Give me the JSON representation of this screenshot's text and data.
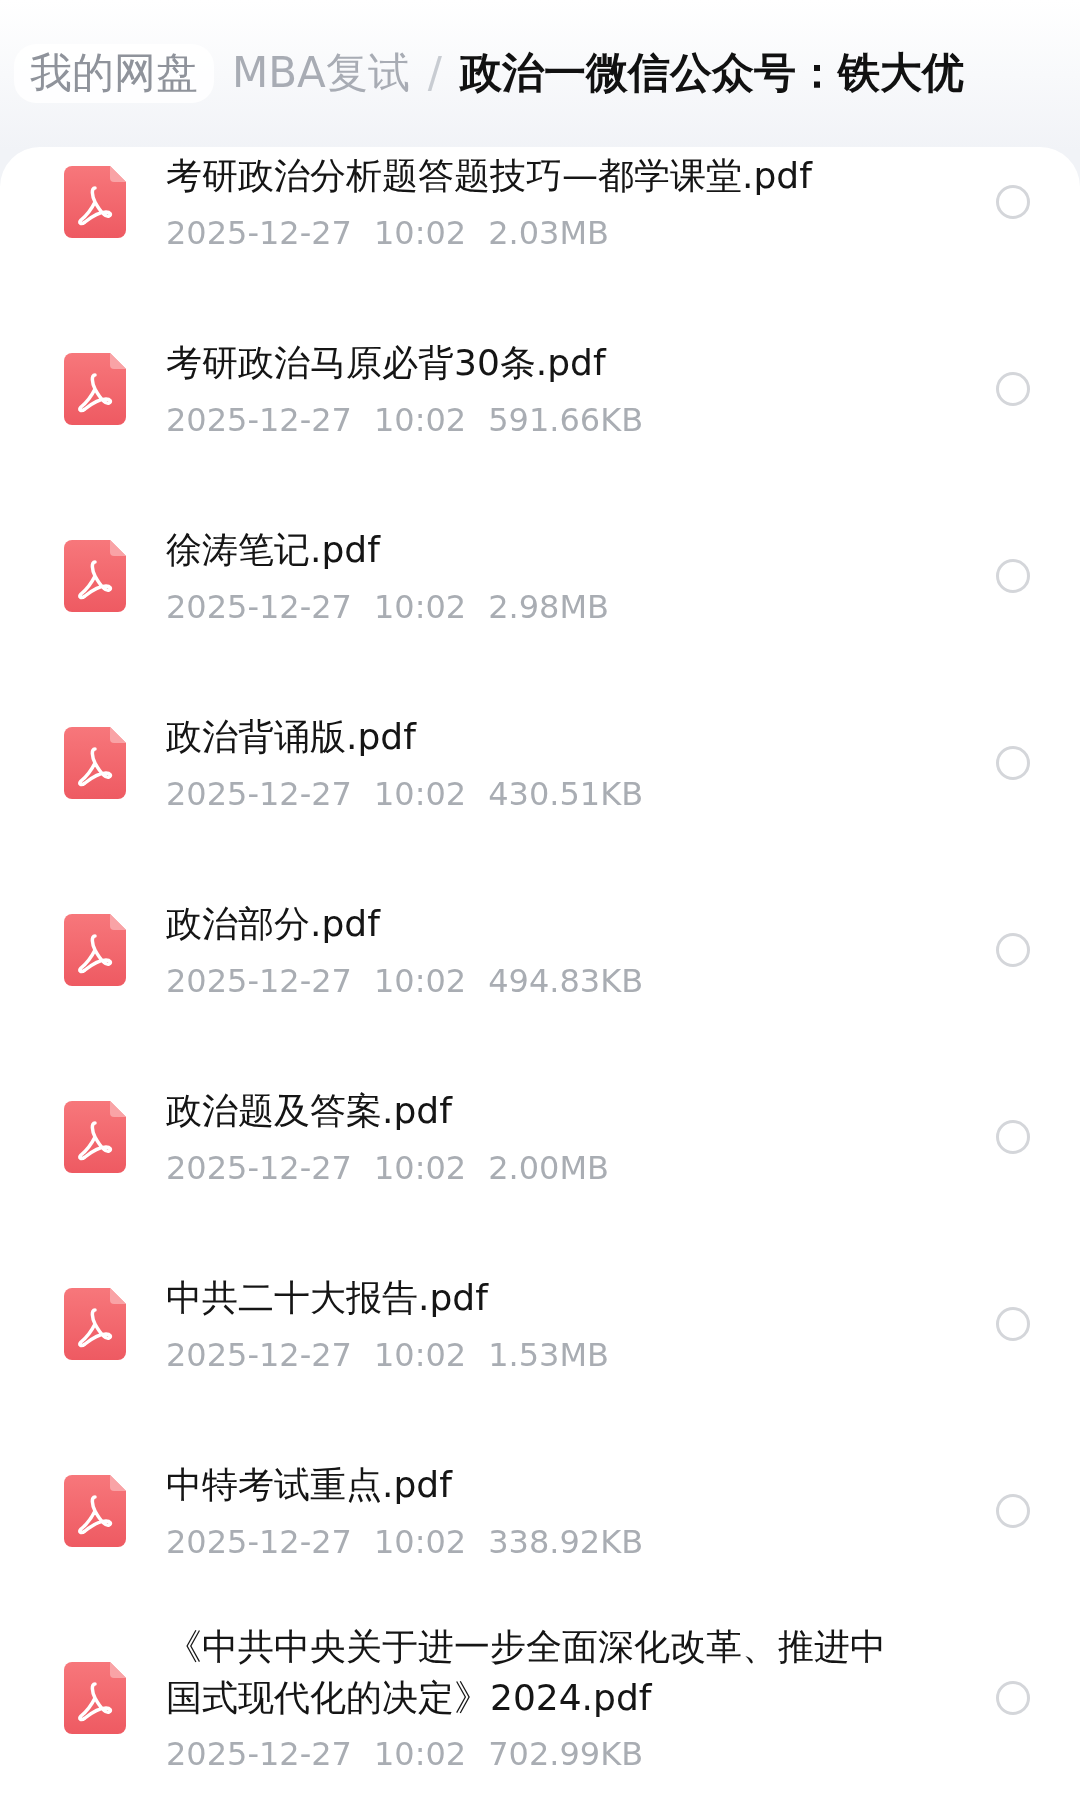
{
  "breadcrumb": [
    {
      "label": "我的网盘",
      "kind": "root"
    },
    {
      "label": "MBA复试",
      "kind": "folder"
    },
    {
      "label": "/",
      "kind": "separator"
    },
    {
      "label": "政治一微信公众号：铁大优",
      "kind": "current"
    }
  ],
  "files": [
    {
      "name": "考研政治分析题答题技巧—都学课堂.pdf",
      "date": "2025-12-27",
      "time": "10:02",
      "size": "2.03MB",
      "selected": false
    },
    {
      "name": "考研政治马原必背30条.pdf",
      "date": "2025-12-27",
      "time": "10:02",
      "size": "591.66KB",
      "selected": false
    },
    {
      "name": "徐涛笔记.pdf",
      "date": "2025-12-27",
      "time": "10:02",
      "size": "2.98MB",
      "selected": false
    },
    {
      "name": "政治背诵版.pdf",
      "date": "2025-12-27",
      "time": "10:02",
      "size": "430.51KB",
      "selected": false
    },
    {
      "name": "政治部分.pdf",
      "date": "2025-12-27",
      "time": "10:02",
      "size": "494.83KB",
      "selected": false
    },
    {
      "name": "政治题及答案.pdf",
      "date": "2025-12-27",
      "time": "10:02",
      "size": "2.00MB",
      "selected": false
    },
    {
      "name": "中共二十大报告.pdf",
      "date": "2025-12-27",
      "time": "10:02",
      "size": "1.53MB",
      "selected": false
    },
    {
      "name": "中特考试重点.pdf",
      "date": "2025-12-27",
      "time": "10:02",
      "size": "338.92KB",
      "selected": false
    },
    {
      "name": "《中共中央关于进一步全面深化改革、推进中国式现代化的决定》2024.pdf",
      "date": "2025-12-27",
      "time": "10:02",
      "size": "702.99KB",
      "selected": false
    }
  ]
}
